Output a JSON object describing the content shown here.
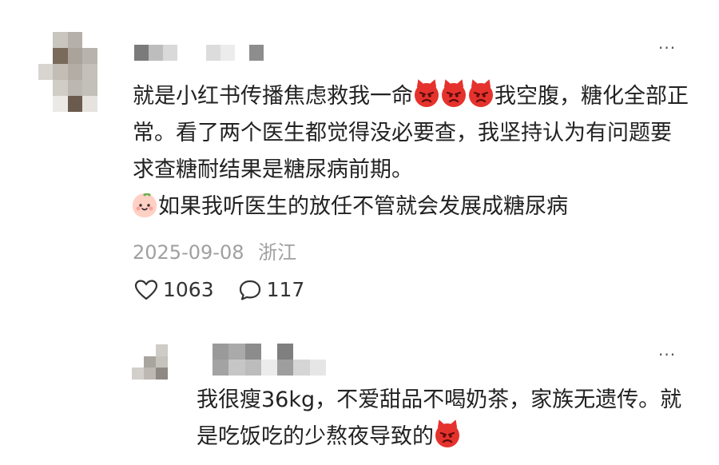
{
  "comment": {
    "text_part1": "就是小红书传播焦虑救我一命",
    "text_part2": "我空腹，糖化全部正常。看了两个医生都觉得没必要查，我坚持认为有问题要求查糖耐结果是糖尿病前期。",
    "text_part3": "如果我听医生的放任不管就会发展成糖尿病",
    "date": "2025-09-08",
    "location": "浙江",
    "likes": "1063",
    "replies": "117",
    "more_label": "···"
  },
  "reply": {
    "text_part1": "我很瘦36kg，不爱甜品不喝奶茶，家族无遗传。就是吃饭吃的少熬夜导致的",
    "more_label": "···"
  },
  "icons": {
    "angry_devil": "angry-devil-emoji",
    "peach_face": "peach-face-emoji",
    "like": "heart-outline-icon",
    "reply": "speech-bubble-icon",
    "more": "more-dots-icon"
  },
  "colors": {
    "text": "#222222",
    "meta": "#a0a0a0",
    "devil_emoji": "#e5322d"
  }
}
